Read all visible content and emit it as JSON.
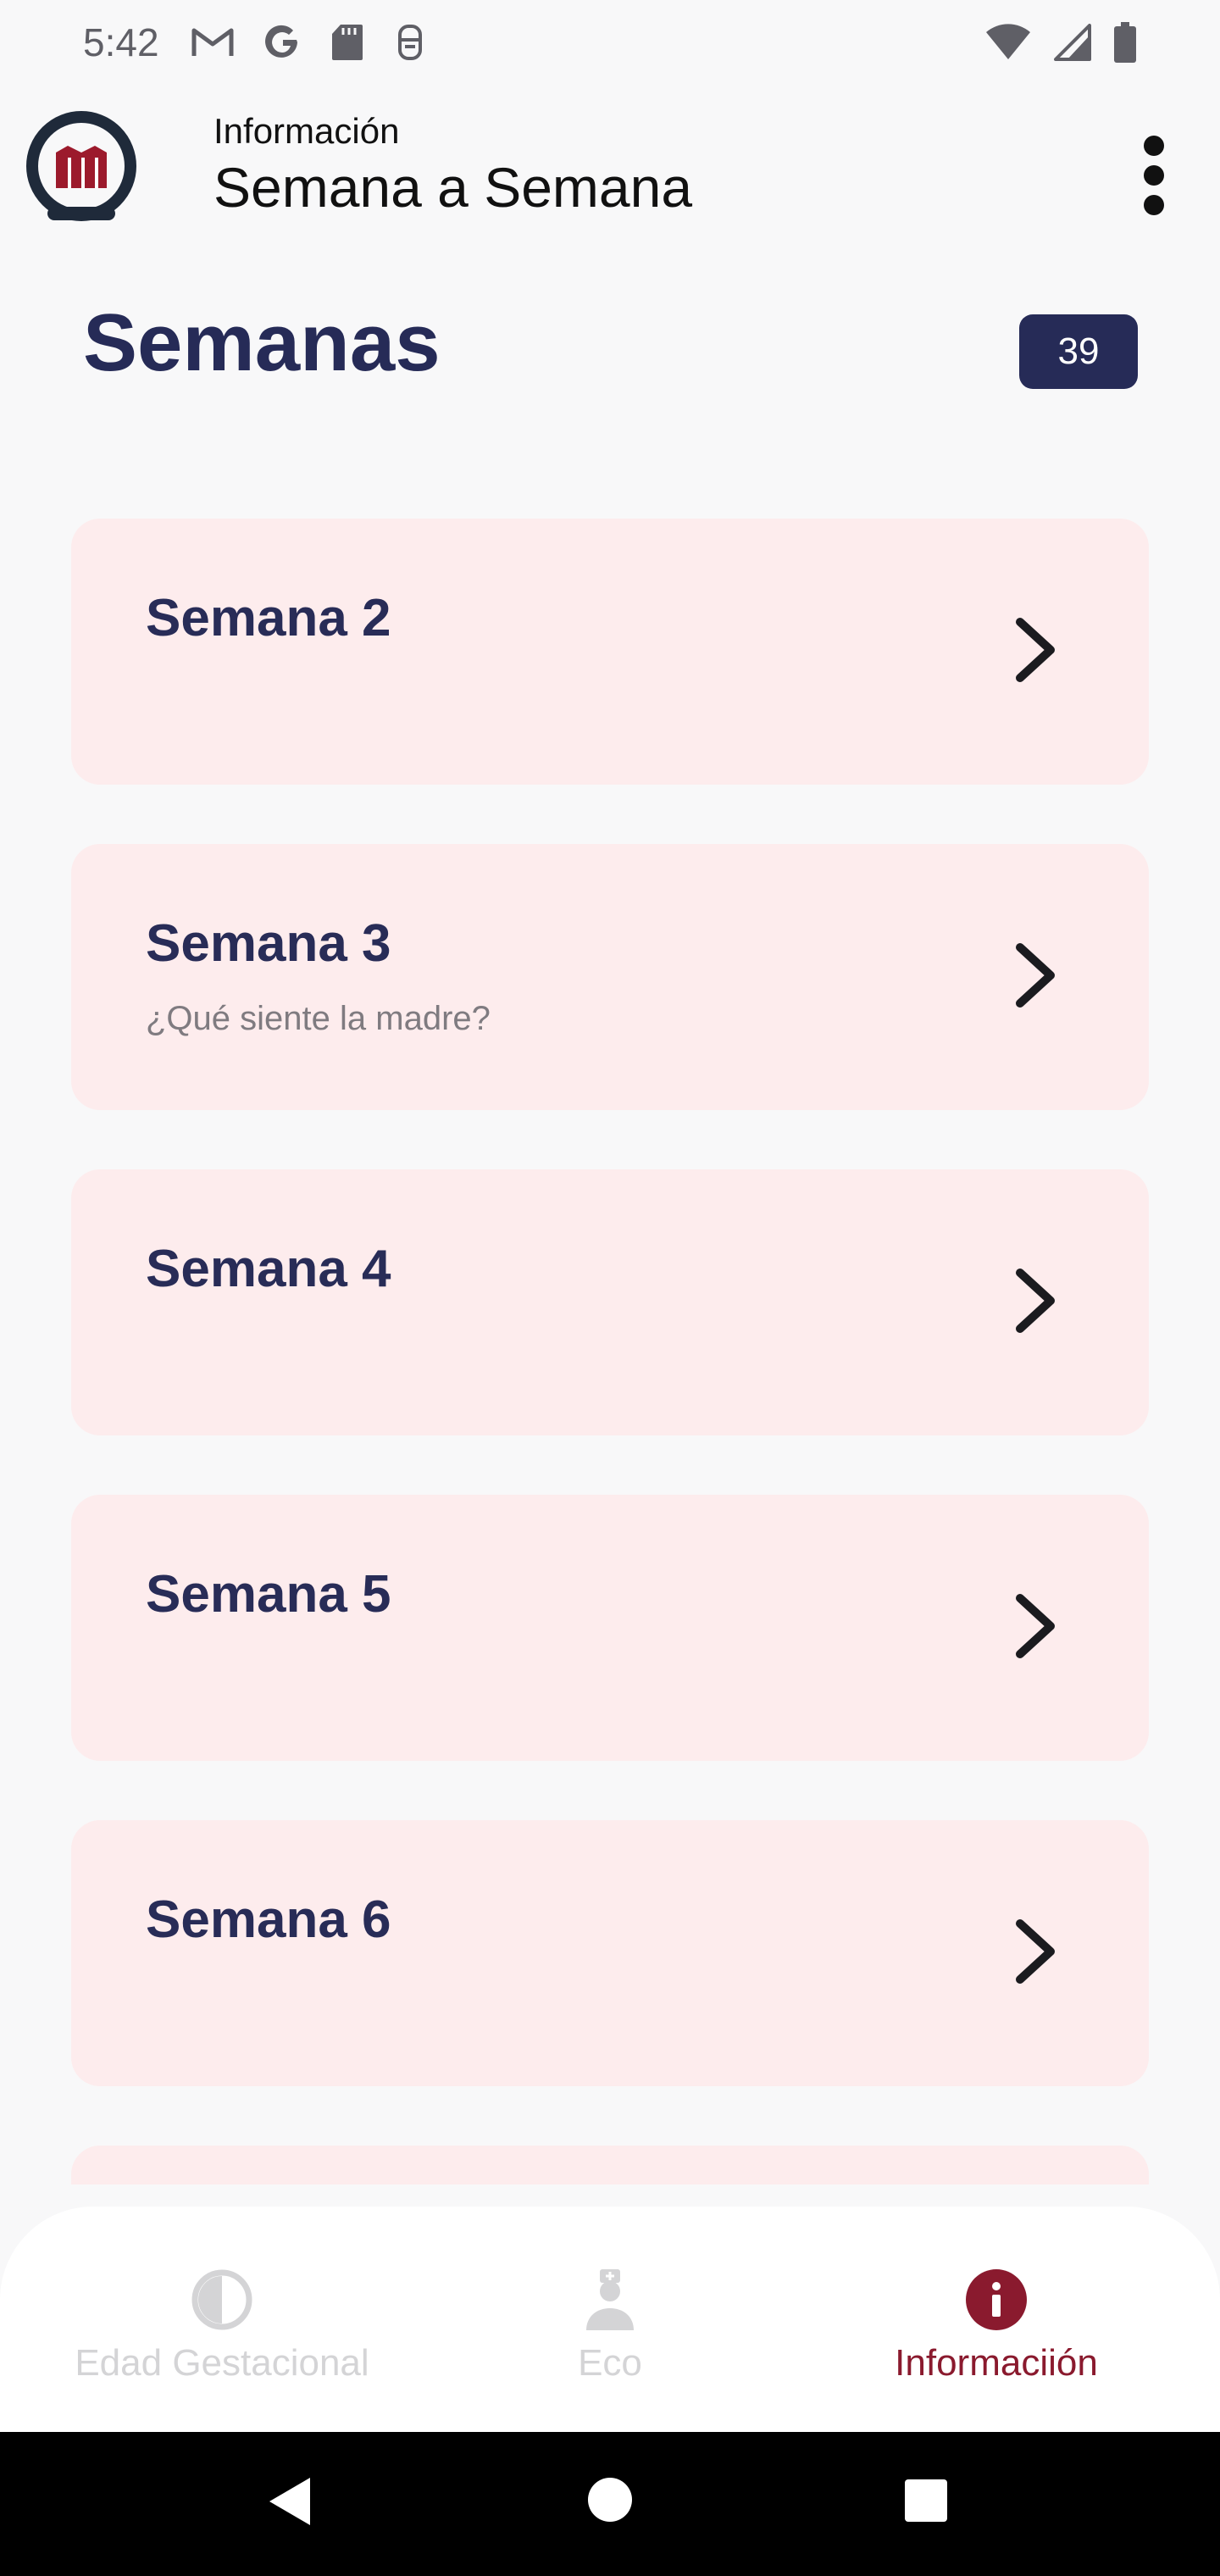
{
  "status_bar": {
    "time": "5:42",
    "left_icons": [
      "gmail-icon",
      "google-icon",
      "sd-card-icon",
      "notification-app-icon"
    ],
    "right_icons": [
      "wifi-icon",
      "cell-signal-icon",
      "battery-icon"
    ]
  },
  "app_bar": {
    "subtitle": "Información",
    "title": "Semana a Semana",
    "logo_icon": "hospital-logo-icon",
    "menu_icon": "more-vertical-icon"
  },
  "section": {
    "title": "Semanas",
    "count": "39"
  },
  "weeks": [
    {
      "title": "Semana 2",
      "subtitle": ""
    },
    {
      "title": "Semana 3",
      "subtitle": "¿Qué siente la madre?"
    },
    {
      "title": "Semana 4",
      "subtitle": ""
    },
    {
      "title": "Semana 5",
      "subtitle": ""
    },
    {
      "title": "Semana 6",
      "subtitle": ""
    },
    {
      "title": "",
      "subtitle": ""
    }
  ],
  "bottom_nav": {
    "items": [
      {
        "label": "Edad Gestacional",
        "icon": "half-circle-icon",
        "active": false
      },
      {
        "label": "Eco",
        "icon": "doctor-icon",
        "active": false
      },
      {
        "label": "Informaciión",
        "icon": "info-icon",
        "active": true
      }
    ]
  },
  "colors": {
    "primary": "#262b57",
    "card_background": "#fdeced",
    "accent": "#8a1a2e",
    "inactive": "#d4d4d6"
  }
}
